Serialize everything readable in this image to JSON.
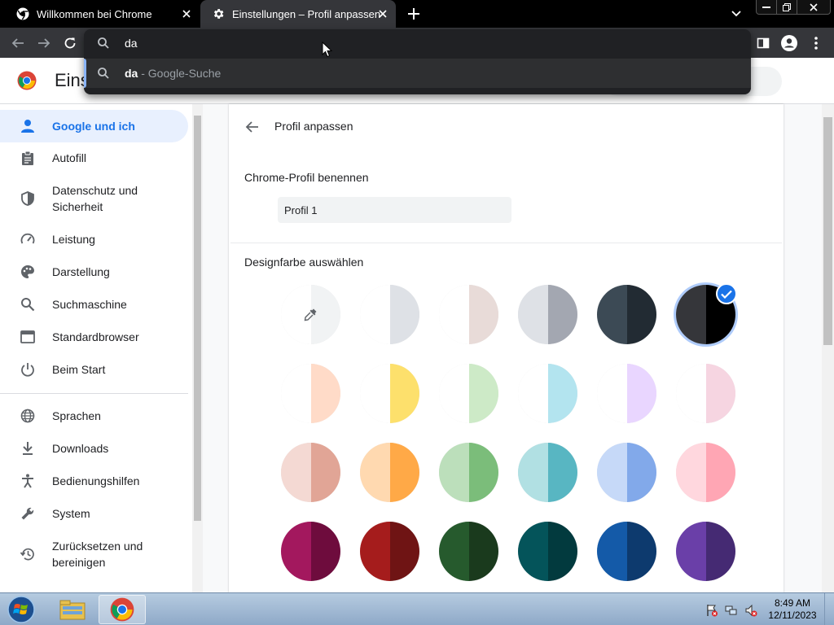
{
  "tabs": [
    {
      "title": "Willkommen bei Chrome",
      "active": false
    },
    {
      "title": "Einstellungen – Profil anpassen",
      "active": true
    }
  ],
  "omnibox": {
    "value": "da",
    "suggestion_query": "da",
    "suggestion_suffix": " - Google-Suche"
  },
  "settings": {
    "title": "Einstellungen"
  },
  "sidebar": {
    "items": [
      {
        "label": "Google und ich",
        "icon": "person-icon",
        "selected": true
      },
      {
        "label": "Autofill",
        "icon": "clipboard-icon"
      },
      {
        "label": "Datenschutz und Sicherheit",
        "icon": "shield-icon"
      },
      {
        "label": "Leistung",
        "icon": "speedometer-icon"
      },
      {
        "label": "Darstellung",
        "icon": "palette-icon"
      },
      {
        "label": "Suchmaschine",
        "icon": "search-icon"
      },
      {
        "label": "Standardbrowser",
        "icon": "browser-window-icon"
      },
      {
        "label": "Beim Start",
        "icon": "power-icon"
      },
      {
        "label": "Sprachen",
        "icon": "globe-icon"
      },
      {
        "label": "Downloads",
        "icon": "download-icon"
      },
      {
        "label": "Bedienungshilfen",
        "icon": "accessibility-icon"
      },
      {
        "label": "System",
        "icon": "wrench-icon"
      },
      {
        "label": "Zurücksetzen und bereinigen",
        "icon": "restore-icon"
      }
    ]
  },
  "profile": {
    "page_title": "Profil anpassen",
    "name_section_label": "Chrome-Profil benennen",
    "name_value": "Profil 1",
    "color_section_label": "Designfarbe auswählen",
    "selected_color_index": 5,
    "colors": [
      {
        "left": "#ffffff",
        "right": "#f1f3f4",
        "picker": true
      },
      {
        "left": "#ffffff",
        "right": "#dee1e6"
      },
      {
        "left": "#ffffff",
        "right": "#e8dbd8"
      },
      {
        "left": "#dee1e6",
        "right": "#a3a7b1"
      },
      {
        "left": "#3c4a55",
        "right": "#222b33"
      },
      {
        "left": "#35363a",
        "right": "#000000"
      },
      {
        "left": "#ffffff",
        "right": "#ffdbc8"
      },
      {
        "left": "#ffffff",
        "right": "#fde06c"
      },
      {
        "left": "#ffffff",
        "right": "#cdeac7"
      },
      {
        "left": "#ffffff",
        "right": "#b3e4ef"
      },
      {
        "left": "#ffffff",
        "right": "#e9d6ff"
      },
      {
        "left": "#ffffff",
        "right": "#f6d5e1"
      },
      {
        "left": "#f4d9d3",
        "right": "#e1a596"
      },
      {
        "left": "#ffd9b0",
        "right": "#ffa947"
      },
      {
        "left": "#bcdfbb",
        "right": "#7bbd7a"
      },
      {
        "left": "#b1e0e3",
        "right": "#58b6c2"
      },
      {
        "left": "#c6d9f8",
        "right": "#82a9ea"
      },
      {
        "left": "#ffd7de",
        "right": "#ffa6b4"
      },
      {
        "left": "#a3185e",
        "right": "#6e0c3d"
      },
      {
        "left": "#a51c1c",
        "right": "#6f1414"
      },
      {
        "left": "#265a2d",
        "right": "#1a3a1d"
      },
      {
        "left": "#04545a",
        "right": "#023a3e"
      },
      {
        "left": "#145aa8",
        "right": "#0d3a6e"
      },
      {
        "left": "#6a3fa8",
        "right": "#452a73"
      }
    ]
  },
  "taskbar": {
    "time": "8:49 AM",
    "date": "12/11/2023"
  }
}
